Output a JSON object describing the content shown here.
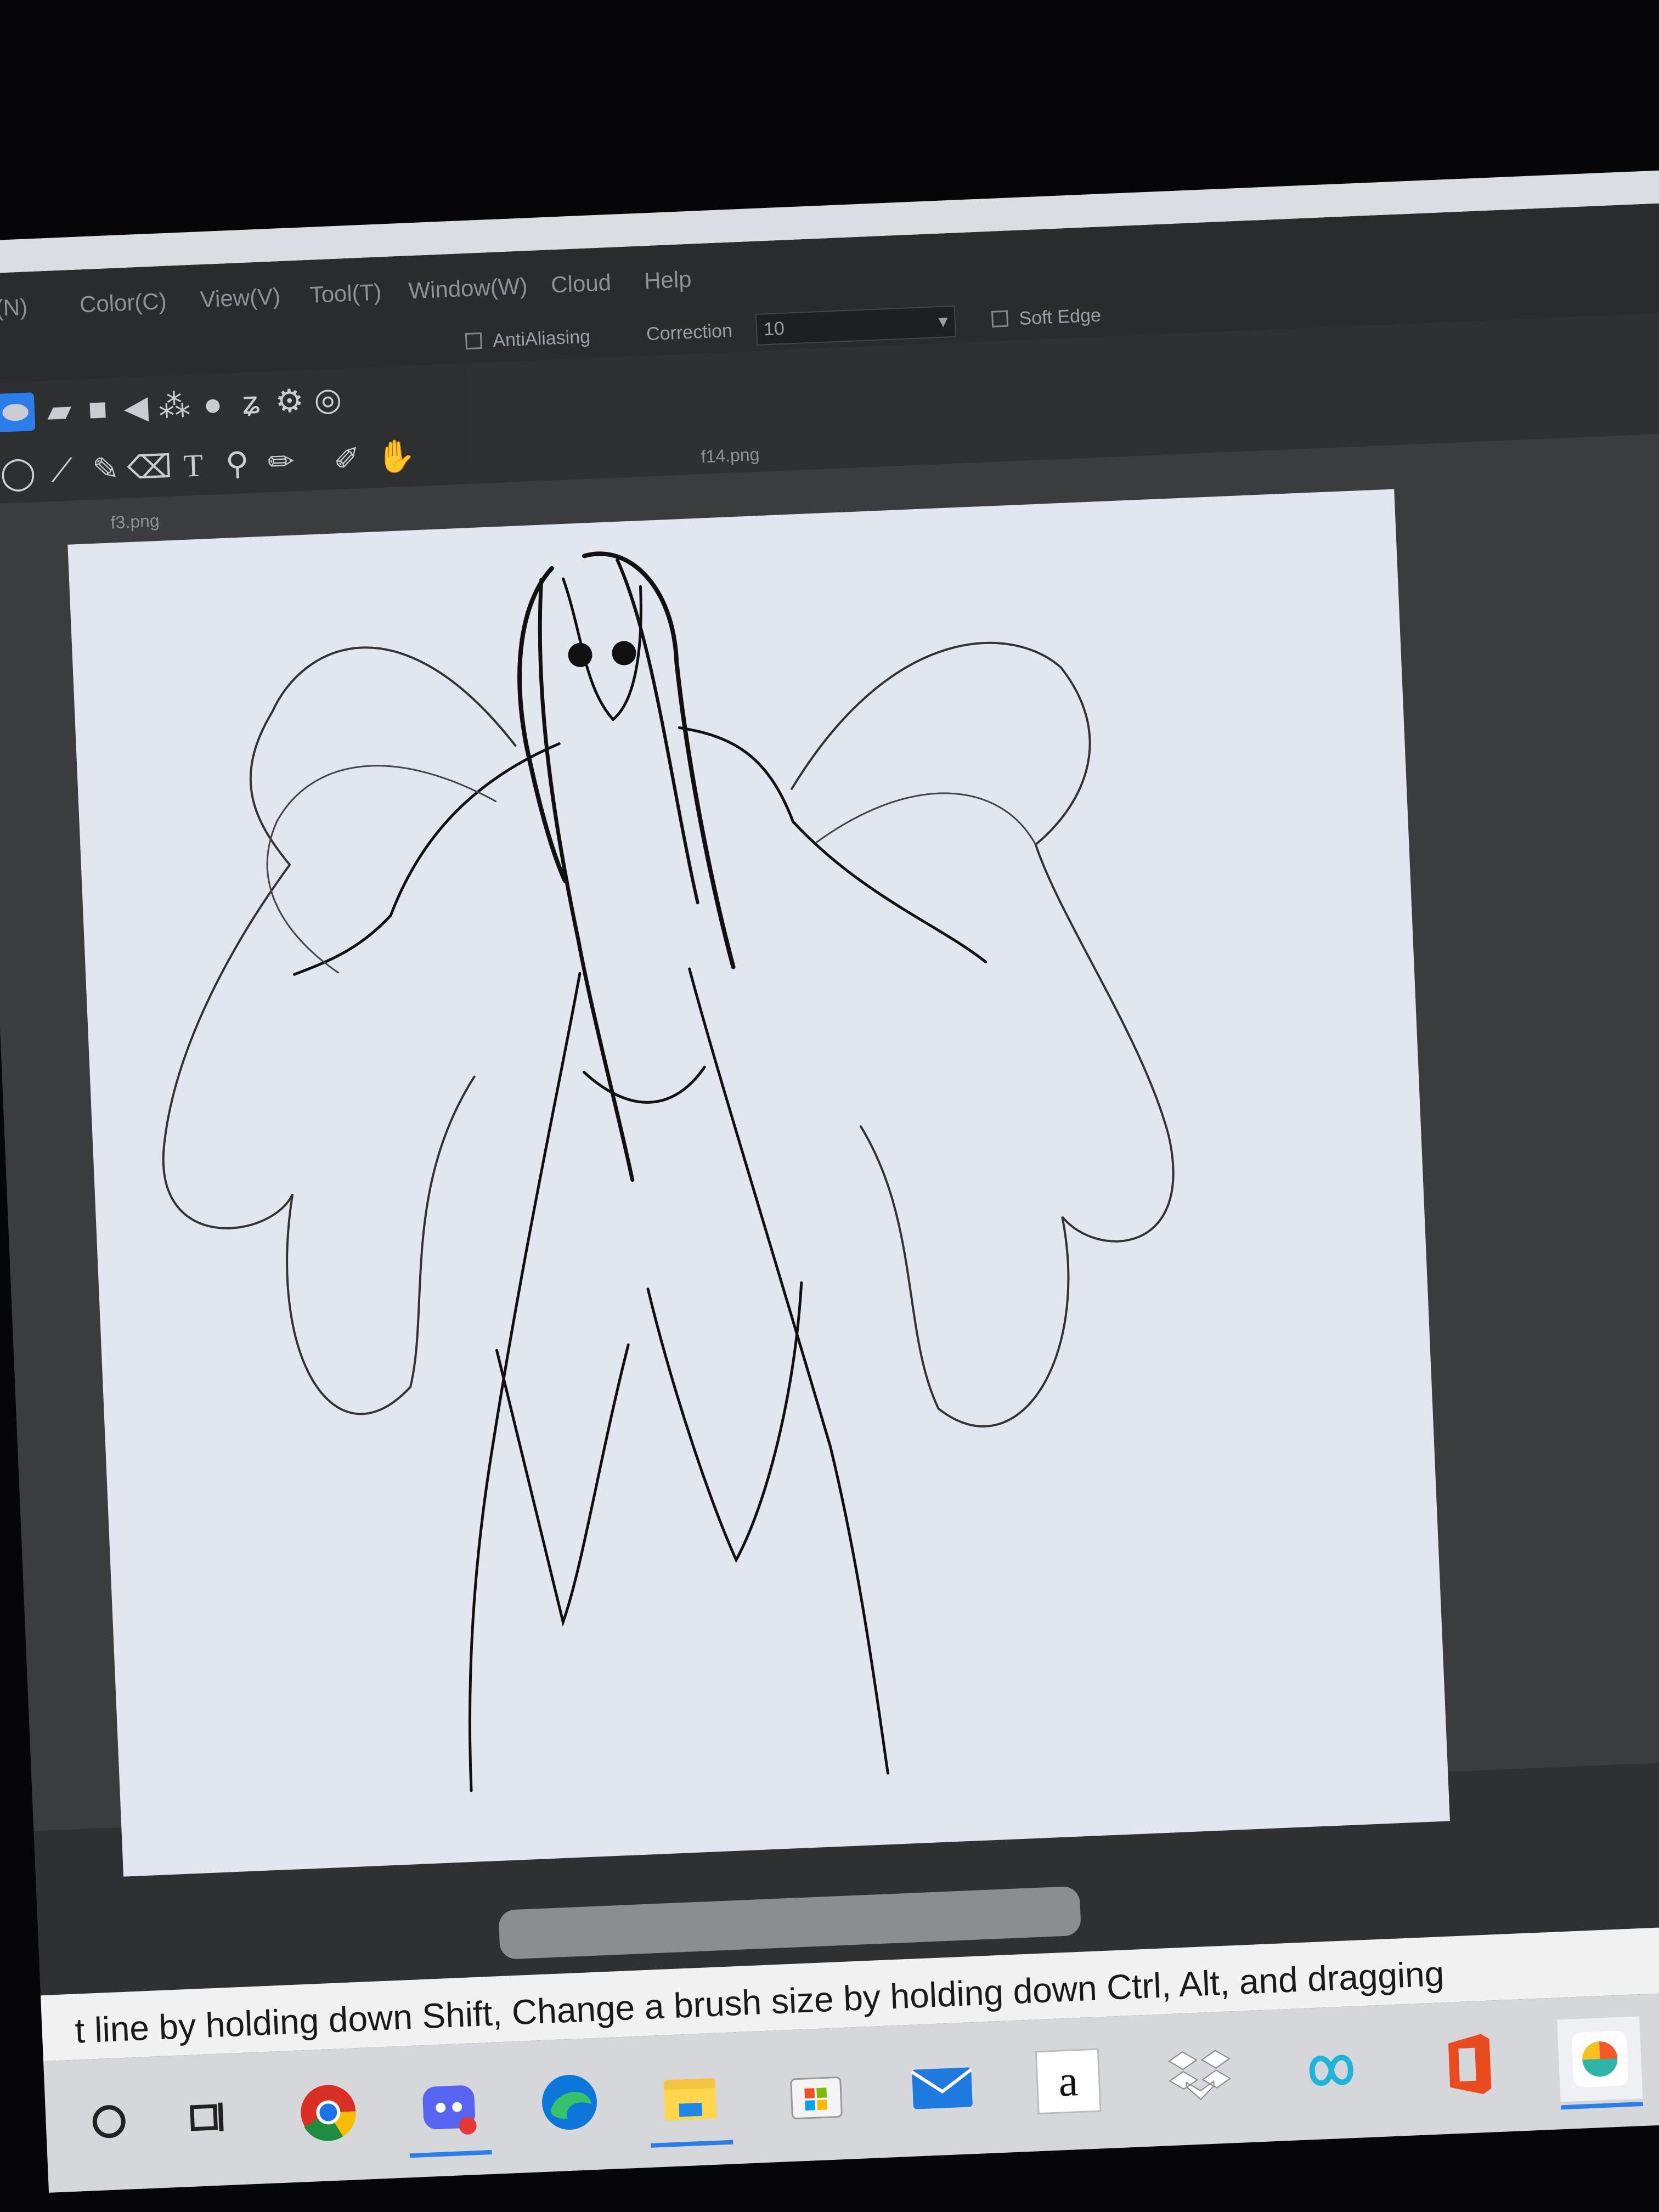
{
  "menu": [
    "ge(N)",
    "Color(C)",
    "View(V)",
    "Tool(T)",
    "Window(W)",
    "Cloud",
    "Help"
  ],
  "options": {
    "antialiasing_label": "AntiAliasing",
    "correction_label": "Correction",
    "correction_value": "10",
    "soft_edge_label": "Soft Edge"
  },
  "tabs": {
    "active_file": "f14.png",
    "other_file": "f3.png"
  },
  "statusbar": {
    "hint": "t line by holding down Shift, Change a brush size by holding down Ctrl, Alt, and dragging"
  },
  "taskbar": {
    "icons": [
      "search-circle",
      "task-view",
      "chrome",
      "discord",
      "edge",
      "file-explorer",
      "microsoft-store",
      "mail",
      "amazon",
      "dropbox",
      "infinity-app",
      "office",
      "medibang"
    ],
    "amazon_glyph": "a"
  },
  "colors": {
    "accent": "#2b7de9",
    "canvas": "#e2e6ef",
    "chrome_dark": "#2a2b2d"
  }
}
